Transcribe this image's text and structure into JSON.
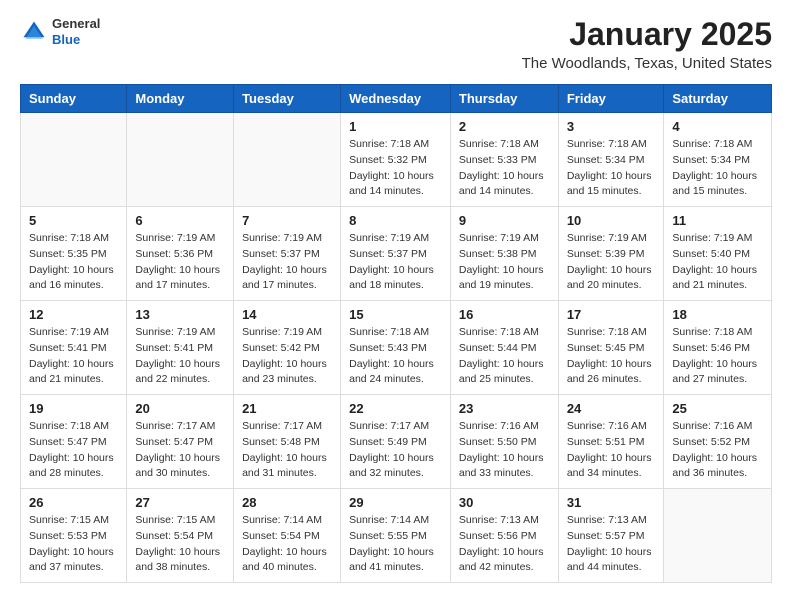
{
  "header": {
    "logo": {
      "general": "General",
      "blue": "Blue"
    },
    "title": "January 2025",
    "subtitle": "The Woodlands, Texas, United States"
  },
  "weekdays": [
    "Sunday",
    "Monday",
    "Tuesday",
    "Wednesday",
    "Thursday",
    "Friday",
    "Saturday"
  ],
  "weeks": [
    [
      {
        "day": "",
        "info": ""
      },
      {
        "day": "",
        "info": ""
      },
      {
        "day": "",
        "info": ""
      },
      {
        "day": "1",
        "info": "Sunrise: 7:18 AM\nSunset: 5:32 PM\nDaylight: 10 hours\nand 14 minutes."
      },
      {
        "day": "2",
        "info": "Sunrise: 7:18 AM\nSunset: 5:33 PM\nDaylight: 10 hours\nand 14 minutes."
      },
      {
        "day": "3",
        "info": "Sunrise: 7:18 AM\nSunset: 5:34 PM\nDaylight: 10 hours\nand 15 minutes."
      },
      {
        "day": "4",
        "info": "Sunrise: 7:18 AM\nSunset: 5:34 PM\nDaylight: 10 hours\nand 15 minutes."
      }
    ],
    [
      {
        "day": "5",
        "info": "Sunrise: 7:18 AM\nSunset: 5:35 PM\nDaylight: 10 hours\nand 16 minutes."
      },
      {
        "day": "6",
        "info": "Sunrise: 7:19 AM\nSunset: 5:36 PM\nDaylight: 10 hours\nand 17 minutes."
      },
      {
        "day": "7",
        "info": "Sunrise: 7:19 AM\nSunset: 5:37 PM\nDaylight: 10 hours\nand 17 minutes."
      },
      {
        "day": "8",
        "info": "Sunrise: 7:19 AM\nSunset: 5:37 PM\nDaylight: 10 hours\nand 18 minutes."
      },
      {
        "day": "9",
        "info": "Sunrise: 7:19 AM\nSunset: 5:38 PM\nDaylight: 10 hours\nand 19 minutes."
      },
      {
        "day": "10",
        "info": "Sunrise: 7:19 AM\nSunset: 5:39 PM\nDaylight: 10 hours\nand 20 minutes."
      },
      {
        "day": "11",
        "info": "Sunrise: 7:19 AM\nSunset: 5:40 PM\nDaylight: 10 hours\nand 21 minutes."
      }
    ],
    [
      {
        "day": "12",
        "info": "Sunrise: 7:19 AM\nSunset: 5:41 PM\nDaylight: 10 hours\nand 21 minutes."
      },
      {
        "day": "13",
        "info": "Sunrise: 7:19 AM\nSunset: 5:41 PM\nDaylight: 10 hours\nand 22 minutes."
      },
      {
        "day": "14",
        "info": "Sunrise: 7:19 AM\nSunset: 5:42 PM\nDaylight: 10 hours\nand 23 minutes."
      },
      {
        "day": "15",
        "info": "Sunrise: 7:18 AM\nSunset: 5:43 PM\nDaylight: 10 hours\nand 24 minutes."
      },
      {
        "day": "16",
        "info": "Sunrise: 7:18 AM\nSunset: 5:44 PM\nDaylight: 10 hours\nand 25 minutes."
      },
      {
        "day": "17",
        "info": "Sunrise: 7:18 AM\nSunset: 5:45 PM\nDaylight: 10 hours\nand 26 minutes."
      },
      {
        "day": "18",
        "info": "Sunrise: 7:18 AM\nSunset: 5:46 PM\nDaylight: 10 hours\nand 27 minutes."
      }
    ],
    [
      {
        "day": "19",
        "info": "Sunrise: 7:18 AM\nSunset: 5:47 PM\nDaylight: 10 hours\nand 28 minutes."
      },
      {
        "day": "20",
        "info": "Sunrise: 7:17 AM\nSunset: 5:47 PM\nDaylight: 10 hours\nand 30 minutes."
      },
      {
        "day": "21",
        "info": "Sunrise: 7:17 AM\nSunset: 5:48 PM\nDaylight: 10 hours\nand 31 minutes."
      },
      {
        "day": "22",
        "info": "Sunrise: 7:17 AM\nSunset: 5:49 PM\nDaylight: 10 hours\nand 32 minutes."
      },
      {
        "day": "23",
        "info": "Sunrise: 7:16 AM\nSunset: 5:50 PM\nDaylight: 10 hours\nand 33 minutes."
      },
      {
        "day": "24",
        "info": "Sunrise: 7:16 AM\nSunset: 5:51 PM\nDaylight: 10 hours\nand 34 minutes."
      },
      {
        "day": "25",
        "info": "Sunrise: 7:16 AM\nSunset: 5:52 PM\nDaylight: 10 hours\nand 36 minutes."
      }
    ],
    [
      {
        "day": "26",
        "info": "Sunrise: 7:15 AM\nSunset: 5:53 PM\nDaylight: 10 hours\nand 37 minutes."
      },
      {
        "day": "27",
        "info": "Sunrise: 7:15 AM\nSunset: 5:54 PM\nDaylight: 10 hours\nand 38 minutes."
      },
      {
        "day": "28",
        "info": "Sunrise: 7:14 AM\nSunset: 5:54 PM\nDaylight: 10 hours\nand 40 minutes."
      },
      {
        "day": "29",
        "info": "Sunrise: 7:14 AM\nSunset: 5:55 PM\nDaylight: 10 hours\nand 41 minutes."
      },
      {
        "day": "30",
        "info": "Sunrise: 7:13 AM\nSunset: 5:56 PM\nDaylight: 10 hours\nand 42 minutes."
      },
      {
        "day": "31",
        "info": "Sunrise: 7:13 AM\nSunset: 5:57 PM\nDaylight: 10 hours\nand 44 minutes."
      },
      {
        "day": "",
        "info": ""
      }
    ]
  ]
}
